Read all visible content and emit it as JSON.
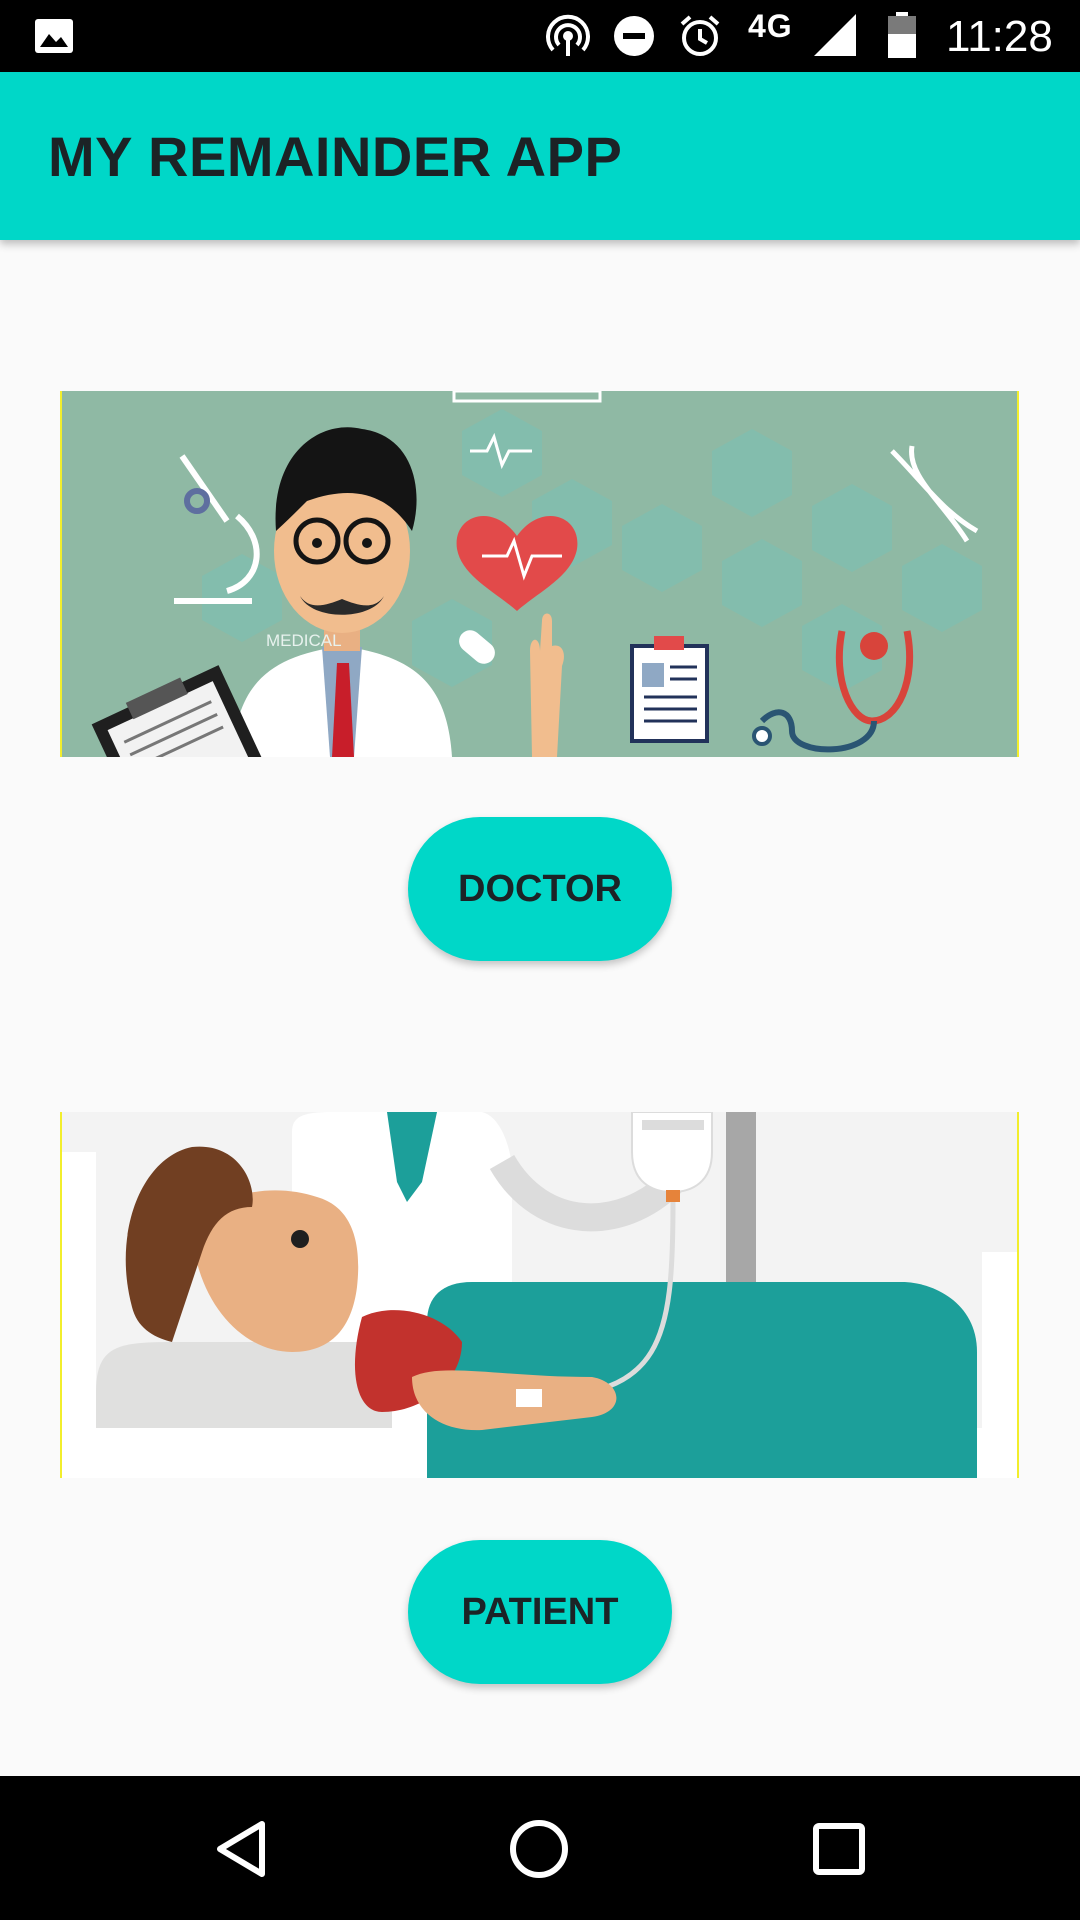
{
  "status_bar": {
    "network": "4G",
    "time": "11:28",
    "icons": [
      "gallery-icon",
      "hotspot-icon",
      "do-not-disturb-icon",
      "alarm-icon",
      "signal-icon",
      "battery-icon"
    ]
  },
  "app_bar": {
    "title": "MY REMAINDER APP"
  },
  "doctor_section": {
    "illustration_text": "MEDICAL",
    "button_label": "DOCTOR"
  },
  "patient_section": {
    "button_label": "PATIENT"
  },
  "nav_bar": {
    "icons": [
      "back-icon",
      "home-icon",
      "recents-icon"
    ]
  },
  "colors": {
    "accent": "#00d7c8",
    "background": "#fafafa",
    "text_dark": "#1c2326",
    "system_bars": "#000000",
    "illustration_border": "#f2ee2c"
  }
}
